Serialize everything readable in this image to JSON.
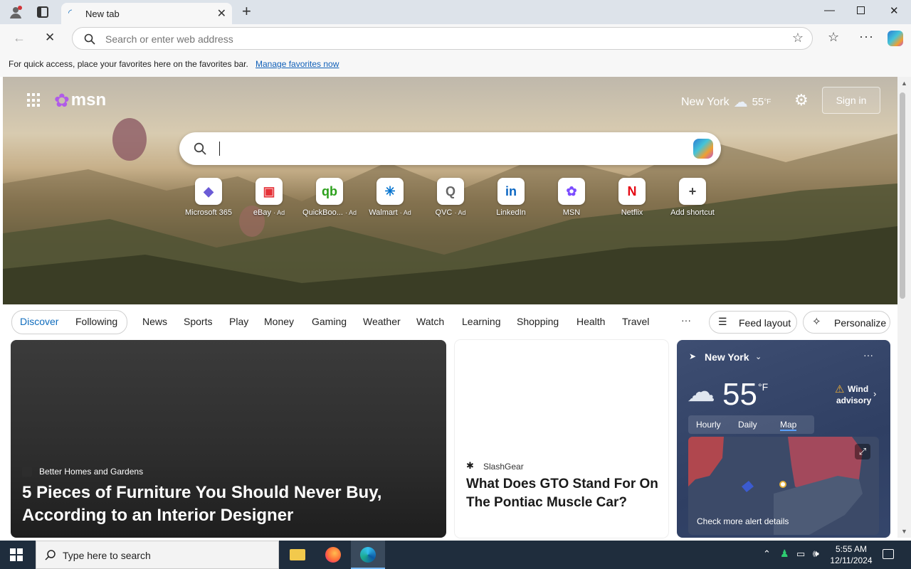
{
  "browser": {
    "tab_title": "New tab",
    "address_placeholder": "Search or enter web address",
    "favorites_message": "For quick access, place your favorites here on the favorites bar.",
    "favorites_link": "Manage favorites now"
  },
  "header": {
    "logo": "msn",
    "location": "New York",
    "temperature": "55",
    "temp_unit": "°F",
    "sign_in": "Sign in"
  },
  "shortcuts": [
    {
      "label": "Microsoft 365",
      "ad": "",
      "glyph": "◆",
      "color": "#6b5bd6"
    },
    {
      "label": "eBay",
      "ad": "· Ad",
      "glyph": "▣",
      "color": "#e53238"
    },
    {
      "label": "QuickBoo...",
      "ad": "· Ad",
      "glyph": "qb",
      "color": "#2ca01c"
    },
    {
      "label": "Walmart",
      "ad": "· Ad",
      "glyph": "✳",
      "color": "#0071ce"
    },
    {
      "label": "QVC",
      "ad": "· Ad",
      "glyph": "Q",
      "color": "#666666"
    },
    {
      "label": "LinkedIn",
      "ad": "",
      "glyph": "in",
      "color": "#0a66c2"
    },
    {
      "label": "MSN",
      "ad": "",
      "glyph": "✿",
      "color": "#7c4dff"
    },
    {
      "label": "Netflix",
      "ad": "",
      "glyph": "N",
      "color": "#e50914"
    },
    {
      "label": "Add shortcut",
      "ad": "",
      "glyph": "+",
      "color": "#444444"
    }
  ],
  "nav": {
    "discover": "Discover",
    "following": "Following",
    "items": [
      "News",
      "Sports",
      "Play",
      "Money",
      "Gaming",
      "Weather",
      "Watch",
      "Learning",
      "Shopping",
      "Health",
      "Travel"
    ],
    "more": "···",
    "feed_layout": "Feed layout",
    "personalize": "Personalize"
  },
  "cards": {
    "main": {
      "source": "Better Homes and Gardens",
      "headline": "5 Pieces of Furniture You Should Never Buy, According to an Interior Designer"
    },
    "second": {
      "source": "SlashGear",
      "headline": "What Does GTO Stand For On The Pontiac Muscle Car?"
    },
    "weather": {
      "location": "New York",
      "temp": "55",
      "unit": "°F",
      "alert_line1": "Wind",
      "alert_line2": "advisory",
      "tabs": [
        "Hourly",
        "Daily",
        "Map"
      ],
      "active_tab": "Map",
      "footer": "Check more alert details"
    }
  },
  "taskbar": {
    "search_placeholder": "Type here to search",
    "time": "5:55 AM",
    "date": "12/11/2024"
  }
}
